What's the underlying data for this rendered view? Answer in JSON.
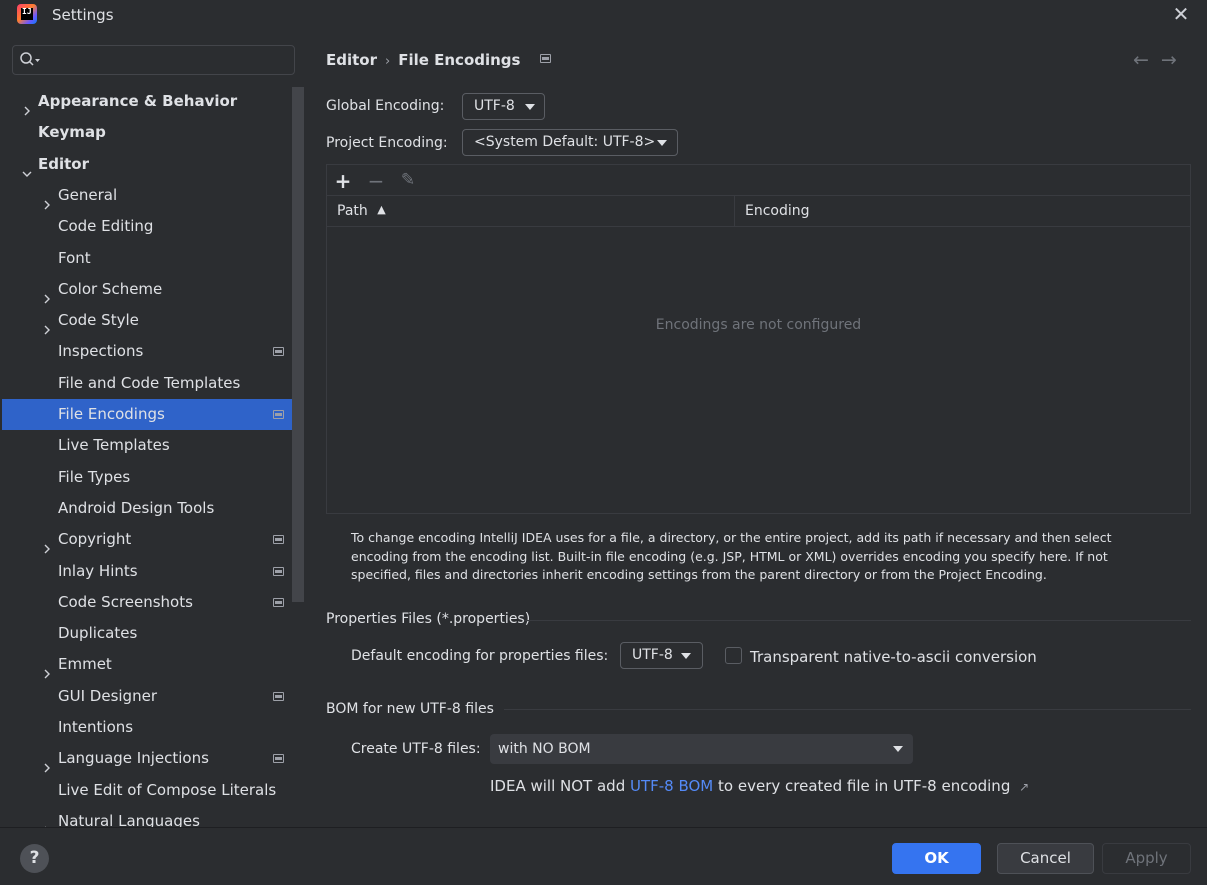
{
  "window": {
    "title": "Settings",
    "logo_text": "IJ"
  },
  "search": {
    "value": "",
    "placeholder": ""
  },
  "sidebar": {
    "items": [
      {
        "label": "Appearance & Behavior",
        "level": 0,
        "expandable": true,
        "expanded": false,
        "bold": true,
        "project": false
      },
      {
        "label": "Keymap",
        "level": 0,
        "expandable": false,
        "bold": true,
        "project": false
      },
      {
        "label": "Editor",
        "level": 0,
        "expandable": true,
        "expanded": true,
        "bold": true,
        "project": false
      },
      {
        "label": "General",
        "level": 1,
        "expandable": true,
        "expanded": false,
        "project": false
      },
      {
        "label": "Code Editing",
        "level": 1,
        "expandable": false,
        "project": false
      },
      {
        "label": "Font",
        "level": 1,
        "expandable": false,
        "project": false
      },
      {
        "label": "Color Scheme",
        "level": 1,
        "expandable": true,
        "expanded": false,
        "project": false
      },
      {
        "label": "Code Style",
        "level": 1,
        "expandable": true,
        "expanded": false,
        "project": false
      },
      {
        "label": "Inspections",
        "level": 1,
        "expandable": false,
        "project": true
      },
      {
        "label": "File and Code Templates",
        "level": 1,
        "expandable": false,
        "project": false
      },
      {
        "label": "File Encodings",
        "level": 1,
        "expandable": false,
        "project": true,
        "selected": true
      },
      {
        "label": "Live Templates",
        "level": 1,
        "expandable": false,
        "project": false
      },
      {
        "label": "File Types",
        "level": 1,
        "expandable": false,
        "project": false
      },
      {
        "label": "Android Design Tools",
        "level": 1,
        "expandable": false,
        "project": false
      },
      {
        "label": "Copyright",
        "level": 1,
        "expandable": true,
        "expanded": false,
        "project": true
      },
      {
        "label": "Inlay Hints",
        "level": 1,
        "expandable": false,
        "project": true
      },
      {
        "label": "Code Screenshots",
        "level": 1,
        "expandable": false,
        "project": true
      },
      {
        "label": "Duplicates",
        "level": 1,
        "expandable": false,
        "project": false
      },
      {
        "label": "Emmet",
        "level": 1,
        "expandable": true,
        "expanded": false,
        "project": false
      },
      {
        "label": "GUI Designer",
        "level": 1,
        "expandable": false,
        "project": true
      },
      {
        "label": "Intentions",
        "level": 1,
        "expandable": false,
        "project": false
      },
      {
        "label": "Language Injections",
        "level": 1,
        "expandable": true,
        "expanded": false,
        "project": true
      },
      {
        "label": "Live Edit of Compose Literals",
        "level": 1,
        "expandable": false,
        "project": false
      },
      {
        "label": "Natural Languages",
        "level": 1,
        "expandable": true,
        "expanded": false,
        "project": false
      }
    ]
  },
  "breadcrumb": {
    "parent": "Editor",
    "separator": "›",
    "current": "File Encodings"
  },
  "nav": {
    "back": "←",
    "forward": "→"
  },
  "global_encoding": {
    "label": "Global Encoding:",
    "value": "UTF-8"
  },
  "project_encoding": {
    "label": "Project Encoding:",
    "value": "<System Default: UTF-8>"
  },
  "table": {
    "toolbar": {
      "add": "+",
      "remove": "−",
      "edit": "✎"
    },
    "columns": [
      "Path",
      "Encoding"
    ],
    "sort_indicator": "▲",
    "rows": [],
    "empty_text": "Encodings are not configured"
  },
  "help_text": "To change encoding IntelliJ IDEA uses for a file, a directory, or the entire project, add its path if necessary and then select encoding from the encoding list. Built-in file encoding (e.g. JSP, HTML or XML) overrides encoding you specify here. If not specified, files and directories inherit encoding settings from the parent directory or from the Project Encoding.",
  "properties_files": {
    "section_title": "Properties Files (*.properties)",
    "default_label": "Default encoding for properties files:",
    "default_value": "UTF-8",
    "transparent_label": "Transparent native-to-ascii conversion",
    "transparent_checked": false
  },
  "bom": {
    "section_title": "BOM for new UTF-8 files",
    "create_label": "Create UTF-8 files:",
    "create_value": "with NO BOM",
    "note_prefix": "IDEA will NOT add ",
    "note_link": "UTF-8 BOM",
    "note_suffix": " to every created file in UTF-8 encoding",
    "note_arrow": "↗"
  },
  "footer": {
    "help": "?",
    "ok": "OK",
    "cancel": "Cancel",
    "apply": "Apply"
  },
  "colors": {
    "background": "#2b2d30",
    "selection": "#2f63c9",
    "accent": "#3574f0",
    "link": "#548af7",
    "muted": "#6f737a"
  }
}
